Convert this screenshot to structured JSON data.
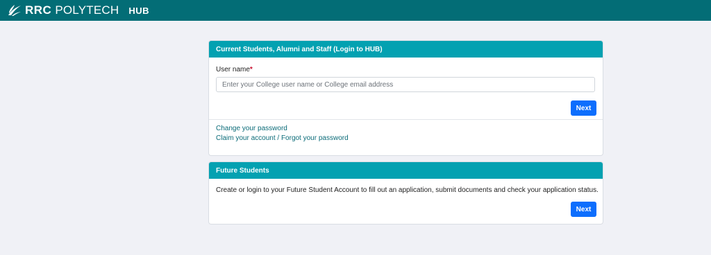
{
  "header": {
    "logo_bold": "RRC",
    "logo_light": "POLYTECH",
    "hub": "HUB"
  },
  "login_card": {
    "title": "Current Students, Alumni and Staff (Login to HUB)",
    "username_label": "User name",
    "required_mark": "*",
    "username_placeholder": "Enter your College user name or College email address",
    "next_label": "Next",
    "change_password": "Change your password",
    "claim_account": "Claim your account",
    "separator": "/",
    "forgot_password": "Forgot your password"
  },
  "future_card": {
    "title": "Future Students",
    "description": "Create or login to your Future Student Account to fill out an application, submit documents and check your application status.",
    "next_label": "Next"
  },
  "colors": {
    "topbar": "#036d76",
    "card_header": "#03a1b1",
    "button": "#0d6efd",
    "link": "#0a6b78",
    "background": "#f0f1f6"
  }
}
